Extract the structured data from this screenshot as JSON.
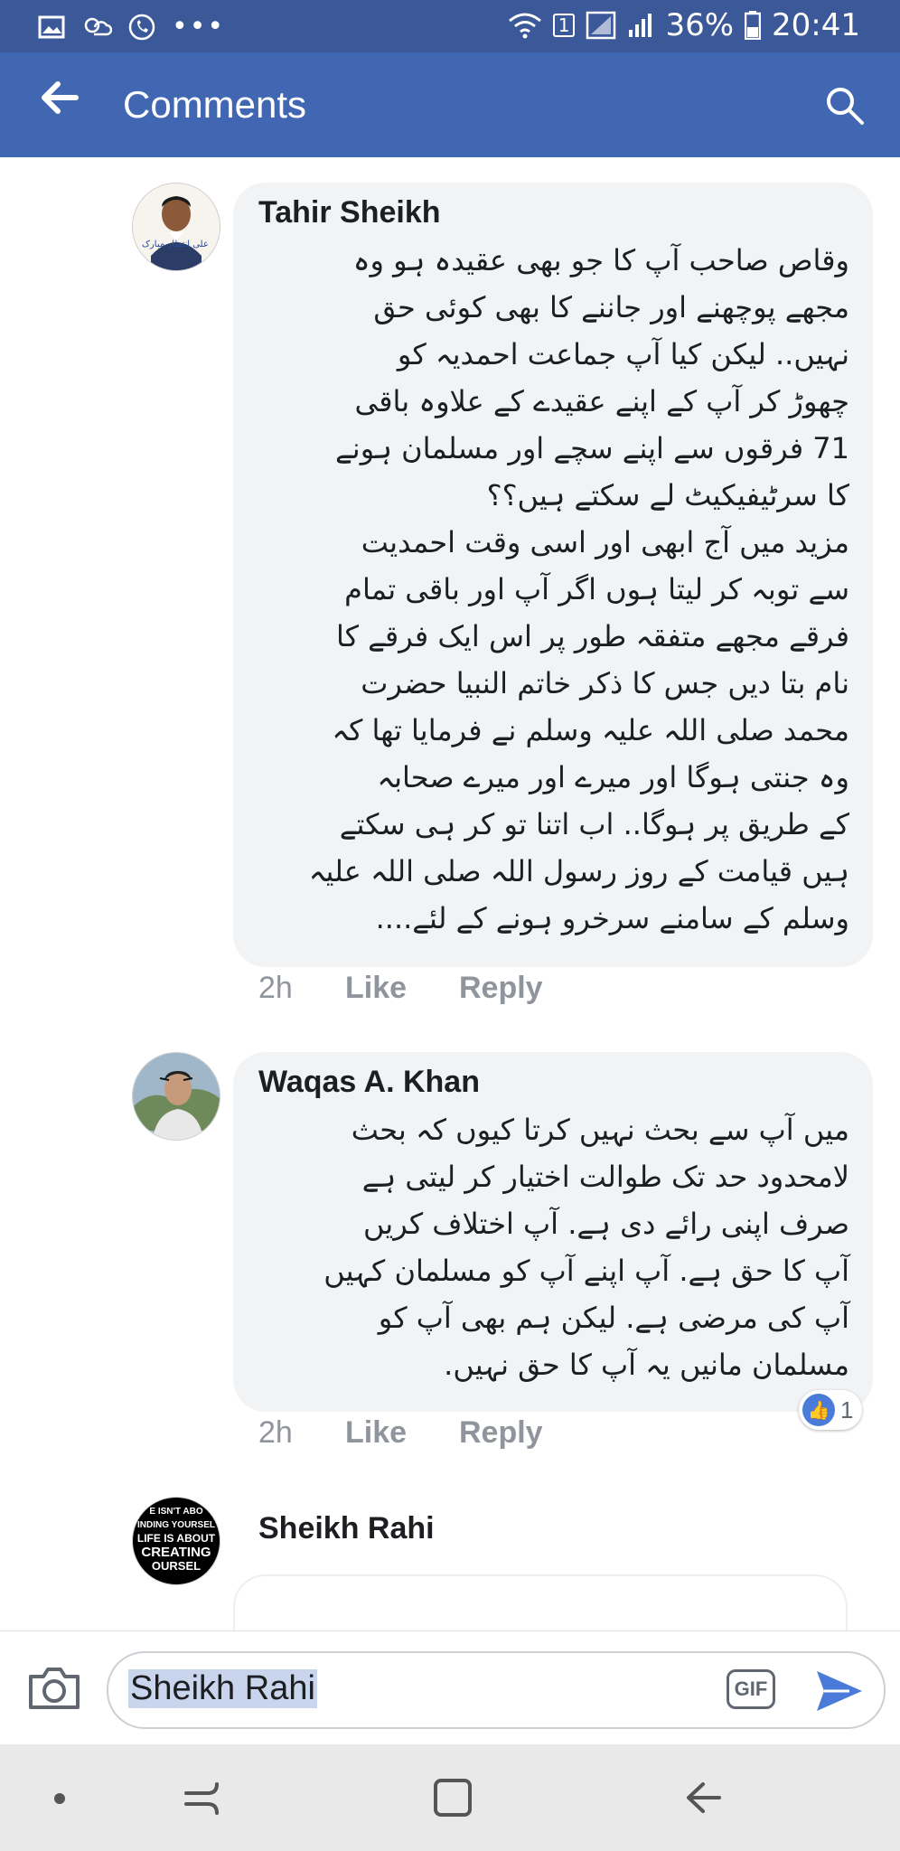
{
  "status_bar": {
    "left_icons": [
      "image-icon",
      "weather-icon",
      "phone-icon",
      "more-dots-icon"
    ],
    "sim_badge": "1",
    "battery": "36%",
    "time": "20:41"
  },
  "appbar": {
    "title": "Comments",
    "back_icon": "arrow-left-icon",
    "search_icon": "search-icon"
  },
  "comments": [
    {
      "author": "Tahir Sheikh",
      "lines": [
        "وقاص صاحب آپ کا جو بھی عقیدہ ہو وہ",
        "مجھے پوچھنے اور جاننے کا بھی کوئی حق",
        "نہیں.. لیکن کیا آپ جماعت احمدیہ کو",
        "چھوڑ کر آپ کے اپنے عقیدے کے علاوہ باقی",
        "71 فرقوں سے اپنے سچے اور مسلمان ہونے",
        "کا سرٹیفیکیٹ لے سکتے ہیں؟؟",
        "مزید میں آج ابھی اور اسی وقت احمدیت",
        "سے توبہ کر لیتا ہوں اگر آپ اور باقی تمام",
        "فرقے مجھے متفقہ طور پر اس ایک فرقے کا",
        "نام بتا دیں جس کا ذکر خاتم النبیا حضرت",
        "محمد صلی اللہ علیہ وسلم نے فرمایا تھا کہ",
        "وہ جنتی ہوگا اور میرے اور میرے صحابہ",
        "کے طریق پر ہوگا.. اب اتنا تو کر ہی سکتے",
        "ہیں قیامت کے روز رسول اللہ صلی اللہ علیہ",
        "وسلم کے سامنے سرخرو ہونے کے لئے...."
      ],
      "time": "2h",
      "like": "Like",
      "reply": "Reply"
    },
    {
      "author": "Waqas A. Khan",
      "lines": [
        "میں آپ سے بحث نہیں کرتا کیوں کہ بحث",
        "لامحدود حد تک طوالت اختیار کر لیتی ہے",
        "صرف اپنی رائے دی ہے. آپ اختلاف کریں",
        "آپ کا حق ہے. آپ اپنے آپ کو مسلمان کہیں",
        "آپ کی مرضی ہے. لیکن ہم بھی آپ کو",
        "مسلمان مانیں یہ آپ کا حق نہیں."
      ],
      "time": "2h",
      "like": "Like",
      "reply": "Reply",
      "reaction_count": "1"
    },
    {
      "author": "Sheikh Rahi",
      "avatar_text": [
        "E ISN'T ABO",
        "INDING YOURSEL",
        "LIFE IS ABOUT",
        "CREATING",
        "OURSEL"
      ]
    }
  ],
  "avatar1_text": "علی انتظار مبارک",
  "composer": {
    "value": "Sheikh Rahi",
    "gif_label": "GIF"
  }
}
